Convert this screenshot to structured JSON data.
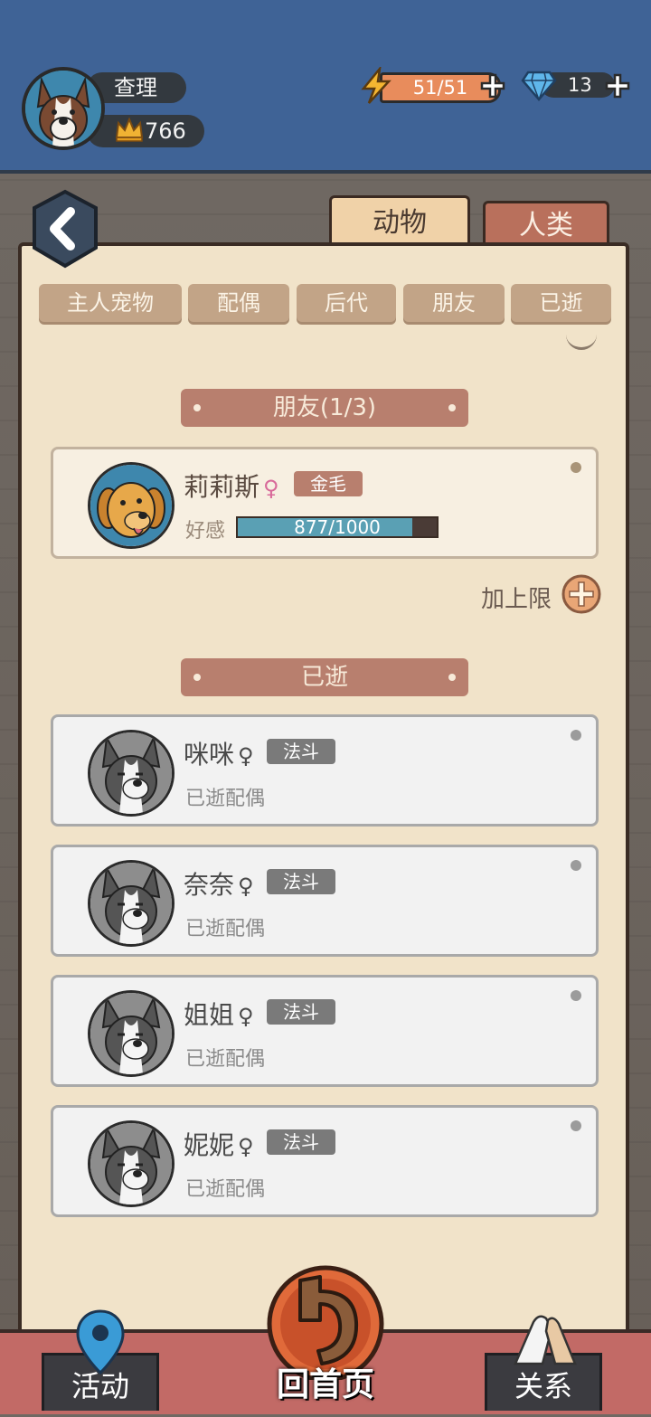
{
  "header": {
    "player_name": "查理",
    "score": "766",
    "energy": "51/51",
    "gems": "13"
  },
  "top_tabs": {
    "animal": "动物",
    "human": "人类"
  },
  "sub_tabs": [
    "主人宠物",
    "配偶",
    "后代",
    "朋友",
    "已逝"
  ],
  "friends_section": {
    "title": "朋友(1/3)",
    "friend": {
      "name": "莉莉斯",
      "gender": "♀",
      "breed": "金毛",
      "affinity_label": "好感",
      "affinity_value": "877/1000",
      "affinity_fraction": 0.877
    },
    "raise_limit_label": "加上限"
  },
  "deceased_section": {
    "title": "已逝",
    "items": [
      {
        "name": "咪咪",
        "gender": "♀",
        "breed": "法斗",
        "status": "已逝配偶"
      },
      {
        "name": "奈奈",
        "gender": "♀",
        "breed": "法斗",
        "status": "已逝配偶"
      },
      {
        "name": "姐姐",
        "gender": "♀",
        "breed": "法斗",
        "status": "已逝配偶"
      },
      {
        "name": "妮妮",
        "gender": "♀",
        "breed": "法斗",
        "status": "已逝配偶"
      }
    ]
  },
  "bottom_nav": {
    "activities": "活动",
    "home": "回首页",
    "relations": "关系"
  },
  "icons": {
    "energy": "lightning-bolt-icon",
    "gem": "diamond-icon",
    "crown": "crown-icon",
    "back": "chevron-left-icon",
    "plus": "plus-icon",
    "location": "map-pin-icon",
    "home": "return-arrow-icon",
    "relations": "handshake-icon"
  },
  "colors": {
    "header_bg": "#3f6396",
    "panel_bg": "#f1e3c9",
    "section_banner": "#b87f6e",
    "energy_bar": "#e88c5c",
    "affinity_fill": "#5aa0b4",
    "nav_bg": "#c26a66"
  }
}
